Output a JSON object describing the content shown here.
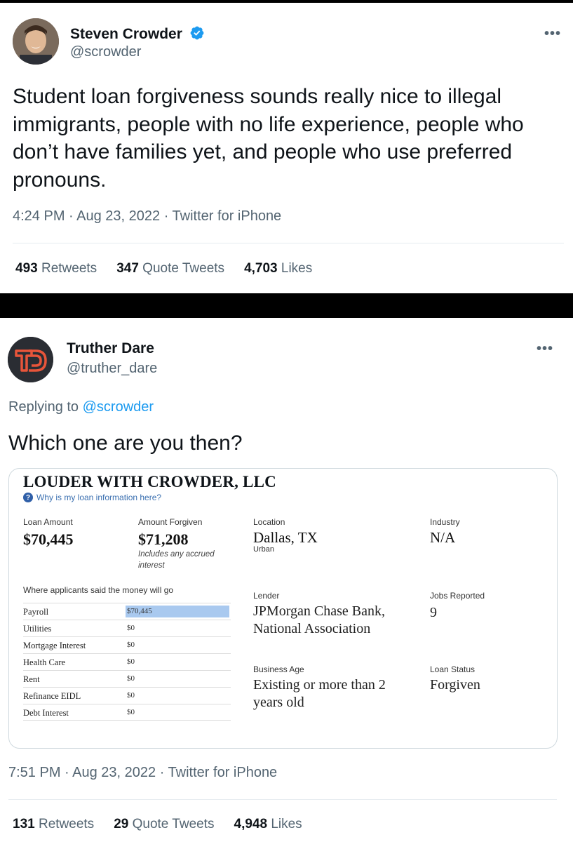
{
  "tweet1": {
    "name": "Steven Crowder",
    "handle": "@scrowder",
    "more": "•••",
    "text": "Student loan forgiveness sounds really nice to illegal immigrants, people with no life experience, people who don’t have families yet, and people who use preferred pronouns.",
    "timestamp": "4:24 PM · Aug 23, 2022 · Twitter for iPhone",
    "stats": {
      "retweets_count": "493",
      "retweets_label": "Retweets",
      "quotes_count": "347",
      "quotes_label": "Quote Tweets",
      "likes_count": "4,703",
      "likes_label": "Likes"
    }
  },
  "tweet2": {
    "name": "Truther Dare",
    "handle": "@truther_dare",
    "more": "•••",
    "replying_prefix": "Replying to",
    "replying_handle": "@scrowder",
    "text": "Which one are you then?",
    "timestamp": "7:51 PM · Aug 23, 2022 · Twitter for iPhone",
    "stats": {
      "retweets_count": "131",
      "retweets_label": "Retweets",
      "quotes_count": "29",
      "quotes_label": "Quote Tweets",
      "likes_count": "4,948",
      "likes_label": "Likes"
    },
    "card": {
      "title": "LOUDER WITH CROWDER, LLC",
      "why_link": "Why is my loan information here?",
      "loan_amount_label": "Loan Amount",
      "loan_amount": "$70,445",
      "amount_forgiven_label": "Amount Forgiven",
      "amount_forgiven": "$71,208",
      "forgiven_note": "Includes any accrued interest",
      "location_label": "Location",
      "location": "Dallas, TX",
      "location_sub": "Urban",
      "industry_label": "Industry",
      "industry": "N/A",
      "money_heading": "Where applicants said the money will go",
      "money_rows": [
        {
          "category": "Payroll",
          "amount": "$70,445",
          "share": 1.0
        },
        {
          "category": "Utilities",
          "amount": "$0",
          "share": 0
        },
        {
          "category": "Mortgage Interest",
          "amount": "$0",
          "share": 0
        },
        {
          "category": "Health Care",
          "amount": "$0",
          "share": 0
        },
        {
          "category": "Rent",
          "amount": "$0",
          "share": 0
        },
        {
          "category": "Refinance EIDL",
          "amount": "$0",
          "share": 0
        },
        {
          "category": "Debt Interest",
          "amount": "$0",
          "share": 0
        }
      ],
      "lender_label": "Lender",
      "lender": "JPMorgan Chase Bank, National Association",
      "jobs_label": "Jobs Reported",
      "jobs": "9",
      "business_age_label": "Business Age",
      "business_age": "Existing or more than 2 years old",
      "loan_status_label": "Loan Status",
      "loan_status": "Forgiven",
      "bar_color": "#a9c9ef"
    }
  },
  "colors": {
    "link": "#1d9bf0",
    "verified": "#1d9bf0",
    "muted": "#536471",
    "td_logo_orange": "#e8553a"
  }
}
